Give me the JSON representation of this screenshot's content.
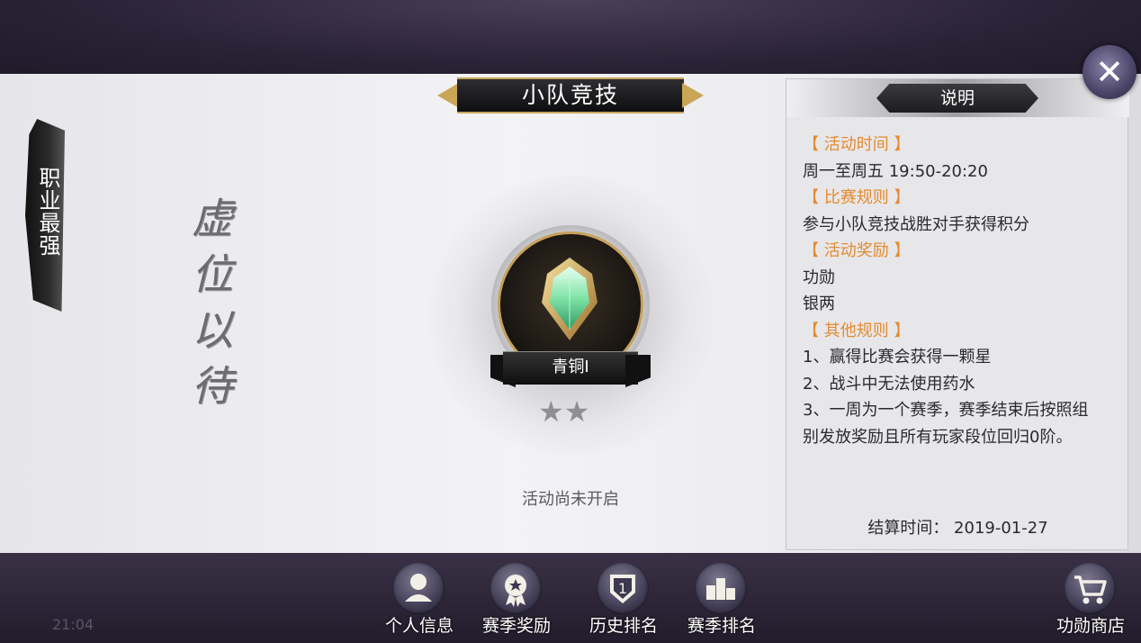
{
  "title": "小队竞技",
  "side_tab": {
    "label": "职业最强"
  },
  "calligraphy": "虚位以待",
  "rank": {
    "name": "青铜I",
    "stars_total": 2,
    "stars_filled": 0
  },
  "status_text": "活动尚未开启",
  "info": {
    "title": "说明",
    "sections": [
      {
        "heading": "【 活动时间 】",
        "lines": [
          "周一至周五 19:50-20:20"
        ]
      },
      {
        "heading": "【 比赛规则 】",
        "lines": [
          "参与小队竞技战胜对手获得积分"
        ]
      },
      {
        "heading": "【 活动奖励 】",
        "lines": [
          "功勋",
          "银两"
        ]
      },
      {
        "heading": "【 其他规则 】",
        "lines": [
          "1、赢得比赛会获得一颗星",
          "2、战斗中无法使用药水",
          "3、一周为一个赛季，赛季结束后按照组",
          "别发放奖励且所有玩家段位回归0阶。"
        ]
      }
    ],
    "settlement": "结算时间： 2019-01-27"
  },
  "nav": [
    {
      "label": "个人信息",
      "icon": "person-icon"
    },
    {
      "label": "赛季奖励",
      "icon": "medal-icon"
    },
    {
      "label": "历史排名",
      "icon": "rank-badge-icon"
    },
    {
      "label": "赛季排名",
      "icon": "podium-icon"
    }
  ],
  "shop": {
    "label": "功勋商店",
    "icon": "cart-icon"
  },
  "clock": "21:04",
  "colors": {
    "section_heading": "#e58a2e",
    "gold_trim": "#c7a45a"
  }
}
